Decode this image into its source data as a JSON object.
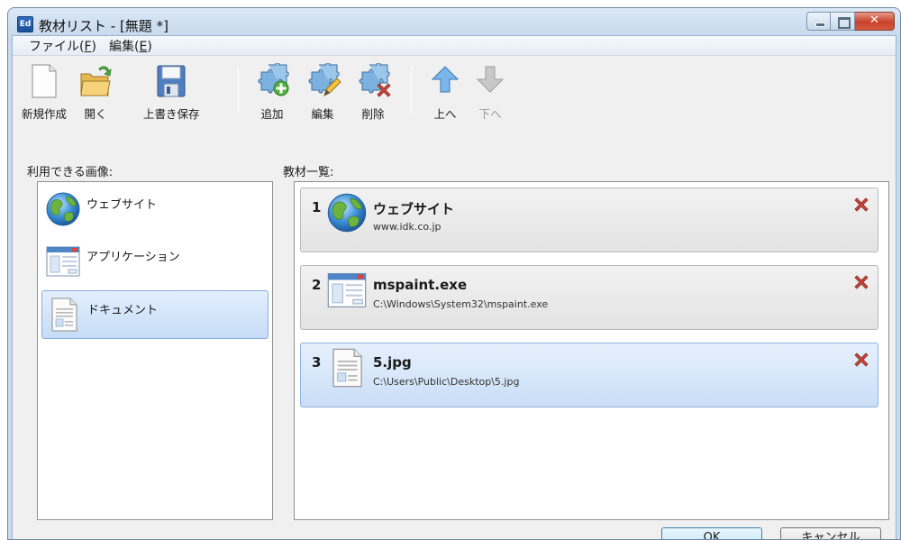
{
  "window": {
    "title": "教材リスト - [無題 *]",
    "app_icon_text": "Ed"
  },
  "menu": {
    "file": {
      "label": "ファイル(",
      "mnemonic": "F",
      "suffix": ")"
    },
    "edit": {
      "label": "編集(",
      "mnemonic": "E",
      "suffix": ")"
    }
  },
  "toolbar": {
    "new_label": "新規作成",
    "open_label": "開く",
    "save_label": "上書き保存",
    "add_label": "追加",
    "edit_label": "編集",
    "delete_label": "削除",
    "up_label": "上へ",
    "down_label": "下へ"
  },
  "available": {
    "heading": "利用できる画像:",
    "items": [
      {
        "label": "ウェブサイト",
        "icon": "globe-icon"
      },
      {
        "label": "アプリケーション",
        "icon": "app-window-icon"
      },
      {
        "label": "ドキュメント",
        "icon": "document-icon",
        "selected": true
      }
    ]
  },
  "materials": {
    "heading": "教材一覧:",
    "items": [
      {
        "number": "1",
        "name": "ウェブサイト",
        "path": "www.idk.co.jp",
        "icon": "globe-icon"
      },
      {
        "number": "2",
        "name": "mspaint.exe",
        "path": "C:\\Windows\\System32\\mspaint.exe",
        "icon": "app-window-icon"
      },
      {
        "number": "3",
        "name": "5.jpg",
        "path": "C:\\Users\\Public\\Desktop\\5.jpg",
        "icon": "document-icon",
        "selected": true
      }
    ]
  },
  "buttons": {
    "ok": "OK",
    "cancel": "キャンセル"
  },
  "colors": {
    "selection": "#cadef6",
    "delete_red": "#c0392b",
    "arrow_up": "#5aa0e0"
  }
}
